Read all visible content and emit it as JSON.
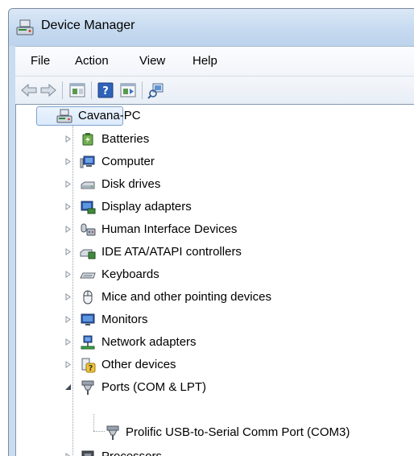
{
  "window": {
    "title": "Device Manager"
  },
  "menu": [
    "File",
    "Action",
    "View",
    "Help"
  ],
  "toolbar": {
    "buttons": [
      "back-icon",
      "forward-icon",
      "properties-icon",
      "help-icon",
      "update-driver-icon",
      "scan-hardware-icon"
    ]
  },
  "tree": {
    "root": "Cavana-PC",
    "items": [
      "Batteries",
      "Computer",
      "Disk drives",
      "Display adapters",
      "Human Interface Devices",
      "IDE ATA/ATAPI controllers",
      "Keyboards",
      "Mice and other pointing devices",
      "Monitors",
      "Network adapters",
      "Other devices",
      "Ports (COM & LPT)",
      "Processors"
    ],
    "ports_children": [
      "Prolific USB-to-Serial Comm Port (COM3)"
    ]
  },
  "colors": {
    "titlebar": "#c6daf0",
    "selection": "#dbeafc",
    "accent": "#1e64b4"
  }
}
